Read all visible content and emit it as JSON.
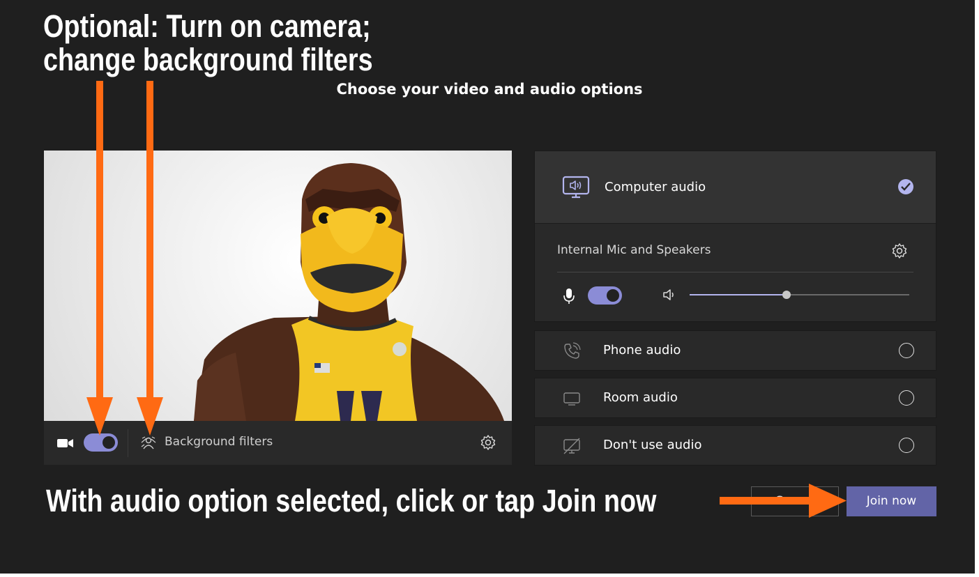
{
  "annotations": {
    "top_line1": "Optional: Turn on camera;",
    "top_line2": "change background filters",
    "bottom": "With audio option selected, click or tap Join now"
  },
  "heading": "Choose your video and audio options",
  "video": {
    "camera_on": true,
    "camera_icon": "video-camera-icon",
    "background_filters_icon": "background-filters-icon",
    "background_filters_label": "Background filters",
    "settings_icon": "gear-icon",
    "preview_subject": "mascot-video-preview"
  },
  "audio": {
    "computer_audio": {
      "label": "Computer audio",
      "icon": "monitor-speaker-icon",
      "selected": true,
      "device_label": "Internal Mic and Speakers",
      "mic_on": true,
      "volume_percent": 44
    },
    "options": [
      {
        "label": "Phone audio",
        "icon": "phone-icon",
        "selected": false
      },
      {
        "label": "Room audio",
        "icon": "room-display-icon",
        "selected": false
      },
      {
        "label": "Don't use audio",
        "icon": "no-audio-icon",
        "selected": false
      }
    ]
  },
  "actions": {
    "cancel_label": "Cancel",
    "join_label": "Join now"
  },
  "colors": {
    "background": "#1f1f1f",
    "accent": "#6264a7",
    "toggle": "#8b8cd6",
    "annotation_arrow": "#ff6a13"
  }
}
